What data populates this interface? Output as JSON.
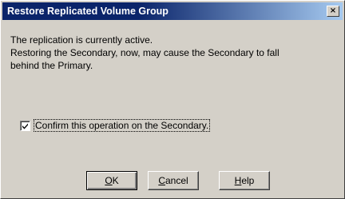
{
  "window": {
    "title": "Restore Replicated Volume Group",
    "close_glyph": "×"
  },
  "message": {
    "line1": "The replication is currently active.",
    "line2": "Restoring the Secondary, now, may cause the Secondary to fall",
    "line3": "behind the Primary."
  },
  "confirm": {
    "checked": true,
    "label": "Confirm this operation on the Secondary."
  },
  "buttons": {
    "ok": {
      "mnemonic": "O",
      "rest": "K"
    },
    "cancel": {
      "mnemonic": "C",
      "rest": "ancel"
    },
    "help": {
      "mnemonic": "H",
      "rest": "elp"
    }
  },
  "colors": {
    "dialog_bg": "#d4d0c8",
    "title_bg_start": "#0a246a",
    "title_bg_end": "#a6caf0",
    "title_text": "#ffffff"
  }
}
